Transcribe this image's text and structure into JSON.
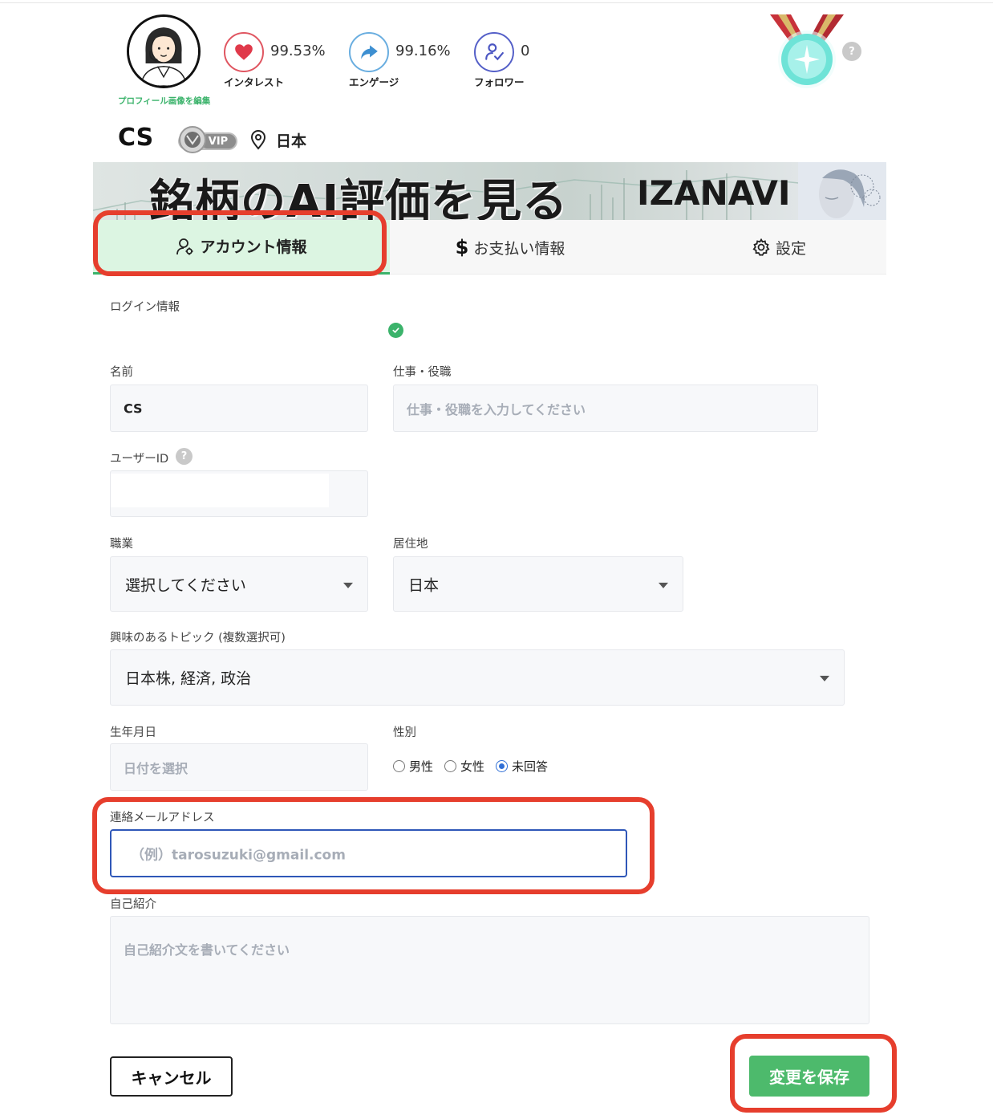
{
  "profile": {
    "edit_photo_link": "プロフィール画像を編集",
    "username": "CS",
    "vip_badge": "VIP",
    "location": "日本",
    "stats": {
      "interest": {
        "value": "99.53%",
        "label": "インタレスト",
        "icon": "heart-icon"
      },
      "engage": {
        "value": "99.16%",
        "label": "エンゲージ",
        "icon": "share-arrow-icon"
      },
      "followers": {
        "value": "0",
        "label": "フォロワー",
        "icon": "user-check-icon"
      }
    },
    "medal_icon": "medal-icon",
    "help_badge": "?"
  },
  "banner": {
    "headline": "銘柄のAI評価を見る",
    "brand": "IZANAVI"
  },
  "tabs": {
    "account": "アカウント情報",
    "payment": "お支払い情報",
    "settings": "設定"
  },
  "form": {
    "login_info_label": "ログイン情報",
    "name_label": "名前",
    "name_value": "CS",
    "job_title_label": "仕事・役職",
    "job_title_placeholder": "仕事・役職を入力してください",
    "user_id_label": "ユーザーID",
    "occupation_label": "職業",
    "occupation_value": "選択してください",
    "residence_label": "居住地",
    "residence_value": "日本",
    "topics_label": "興味のあるトピック (複数選択可)",
    "topics_value": "日本株, 経済, 政治",
    "birthday_label": "生年月日",
    "birthday_placeholder": "日付を選択",
    "gender_label": "性別",
    "gender_options": [
      "男性",
      "女性",
      "未回答"
    ],
    "gender_selected": "未回答",
    "email_label": "連絡メールアドレス",
    "email_placeholder": "（例）tarosuzuki@gmail.com",
    "bio_label": "自己紹介",
    "bio_placeholder": "自己紹介文を書いてください"
  },
  "buttons": {
    "cancel": "キャンセル",
    "save": "変更を保存"
  },
  "colors": {
    "accent_green": "#3bb36b",
    "save_green": "#4dba6c",
    "highlight_red": "#e63e2d",
    "email_border": "#2f57b8",
    "tab_active_bg": "#dcf5e2"
  }
}
